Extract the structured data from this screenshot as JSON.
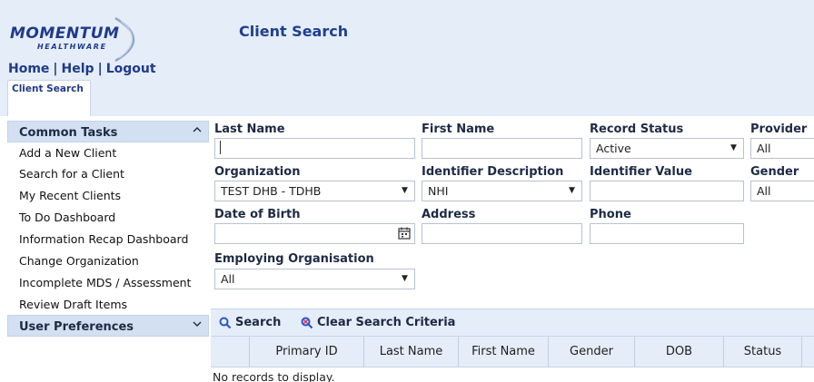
{
  "header": {
    "logo_main": "MOMENTUM",
    "logo_sub": "HEALTHWARE",
    "page_title": "Client Search",
    "nav": [
      "Home",
      "Help",
      "Logout"
    ],
    "tab_label": "Client Search",
    "accent_color": "#1f3a8a",
    "header_bg": "#e4edf8"
  },
  "sidebar": {
    "common_tasks": {
      "title": "Common Tasks",
      "icon": "chevron-up-icon",
      "items": [
        "Add a New Client",
        "Search for a Client",
        "My Recent Clients",
        "To Do Dashboard",
        "Information Recap Dashboard",
        "Change Organization",
        "Incomplete MDS / Assessment",
        "Review Draft Items"
      ]
    },
    "user_preferences": {
      "title": "User Preferences",
      "icon": "chevron-down-icon"
    }
  },
  "form": {
    "last_name": {
      "label": "Last Name",
      "value": ""
    },
    "first_name": {
      "label": "First Name",
      "value": ""
    },
    "record_status": {
      "label": "Record Status",
      "value": "Active"
    },
    "provider": {
      "label": "Provider",
      "value": "All"
    },
    "organization": {
      "label": "Organization",
      "value": "TEST DHB - TDHB"
    },
    "identifier_description": {
      "label": "Identifier Description",
      "value": "NHI"
    },
    "identifier_value": {
      "label": "Identifier Value",
      "value": ""
    },
    "gender": {
      "label": "Gender",
      "value": "All"
    },
    "date_of_birth": {
      "label": "Date of Birth",
      "value": ""
    },
    "address": {
      "label": "Address",
      "value": ""
    },
    "phone": {
      "label": "Phone",
      "value": ""
    },
    "employing_organisation": {
      "label": "Employing Organisation",
      "value": "All"
    }
  },
  "toolbar": {
    "search_label": "Search",
    "clear_label": "Clear Search Criteria"
  },
  "grid": {
    "columns": [
      "",
      "Primary ID",
      "Last Name",
      "First Name",
      "Gender",
      "DOB",
      "Status"
    ],
    "empty_message": "No records to display."
  }
}
